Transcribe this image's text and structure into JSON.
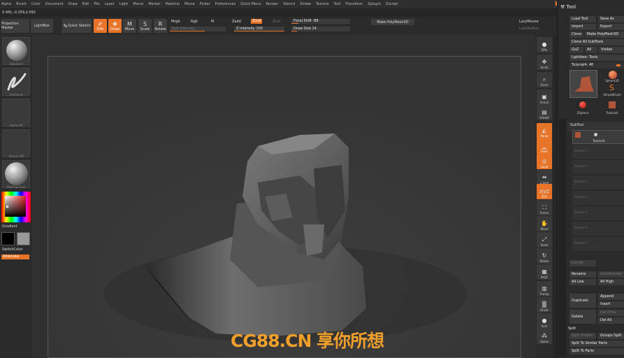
{
  "menu": [
    "Alpha",
    "Brush",
    "Color",
    "Document",
    "Draw",
    "Edit",
    "File",
    "Layer",
    "Light",
    "Macro",
    "Marker",
    "Material",
    "Movie",
    "Picker",
    "Preferences",
    "Quick Menu",
    "Render",
    "Stencil",
    "Stroke",
    "Texture",
    "Tool",
    "Transform",
    "Zplugin",
    "Zscript"
  ],
  "coords": "0.481,-0.259,2.092",
  "toolbar": {
    "projection_master": "Projection Master",
    "lightbox": "LightBox",
    "quick_sketch": "Quick Sketch",
    "edit": "Edit",
    "draw": "Draw",
    "move": "Move",
    "scale": "Scale",
    "rotate": "Rotate",
    "mrgb": "Mrgb",
    "rgb": "Rgb",
    "m": "M",
    "rgb_intensity": "Rgb Intensity",
    "zadd": "Zadd",
    "zsub": "Zsub",
    "zcut": "Zcut",
    "z_intensity": "Z Intensity 100",
    "focal_shift": "Focal Shift -88",
    "draw_size": "Draw Size 14",
    "make_polymesh": "Make PolyMesh3D",
    "lazymouse": "LazyMouse",
    "lazyradius": "LazyRadius"
  },
  "left": {
    "standard": "Standard",
    "freehand": "FreeHand",
    "alpha_off": "Alpha Off",
    "texture_off": "Texture Off",
    "matcap": "MatCap Gray",
    "gradient": "Gradient",
    "switchcolor": "SwitchColor",
    "alternate": "Alternate"
  },
  "right_strip": [
    {
      "label": "SPix",
      "icon": "spix-icon",
      "glyph": "●",
      "orange": false
    },
    {
      "label": "Scroll",
      "icon": "scroll-icon",
      "glyph": "✥",
      "orange": false
    },
    {
      "label": "Zoom",
      "icon": "zoom-icon",
      "glyph": "⌕",
      "orange": false
    },
    {
      "label": "Actual",
      "icon": "actual-icon",
      "glyph": "▣",
      "orange": false
    },
    {
      "label": "AAHalf",
      "icon": "aahalf-icon",
      "glyph": "▤",
      "orange": false
    },
    {
      "label": "Persp",
      "icon": "persp-icon",
      "glyph": "◭",
      "orange": true
    },
    {
      "label": "Floor",
      "icon": "floor-icon",
      "glyph": "▁",
      "orange": true
    },
    {
      "label": "Local",
      "icon": "local-icon",
      "glyph": "◎",
      "orange": true
    },
    {
      "label": "L.Sym",
      "icon": "lsym-icon",
      "glyph": "⇹",
      "orange": false
    },
    {
      "label": "XYZ",
      "icon": "xyz-icon",
      "glyph": "xyz",
      "orange": true
    },
    {
      "label": "Frame",
      "icon": "frame-icon",
      "glyph": "⛶",
      "orange": false
    },
    {
      "label": "Move",
      "icon": "move-icon",
      "glyph": "✋",
      "orange": false
    },
    {
      "label": "Scale",
      "icon": "scale-icon",
      "glyph": "⤢",
      "orange": false
    },
    {
      "label": "Rotate",
      "icon": "rotate-icon",
      "glyph": "↻",
      "orange": false
    },
    {
      "label": "PolyF",
      "icon": "polyf-icon",
      "glyph": "▦",
      "orange": false
    },
    {
      "label": "Transp",
      "icon": "transp-icon",
      "glyph": "▥",
      "orange": false
    },
    {
      "label": "Ghost",
      "icon": "ghost-icon",
      "glyph": "▒",
      "orange": false
    },
    {
      "label": "Solo",
      "icon": "solo-icon",
      "glyph": "●",
      "orange": false
    },
    {
      "label": "Xpose",
      "icon": "xpose-icon",
      "glyph": "⁂",
      "orange": false
    }
  ],
  "toolpanel": {
    "title": "Tool",
    "load_tool": "Load Tool",
    "save_as": "Save As",
    "import": "Import",
    "export": "Export",
    "clone": "Clone",
    "make_polymesh": "Make PolyMesh3D",
    "clone_all": "Clone All SubTools",
    "goz": "GoZ",
    "all": "All",
    "visible": "Visible",
    "lightbox_tools": "Lightbox› Tools",
    "current_tool": "Tutorial4. 48",
    "thumb_sphere": "Sphere3D",
    "thumb_simple": "SimpleBrush",
    "thumb_zsphere": "ZSphere",
    "thumb_tutorial": "Tutorial4",
    "subtool": "SubTool",
    "subtool_first": "Tutorial4",
    "subtool_slots": [
      "Subtool 1",
      "Subtool 2",
      "Subtool 3",
      "Subtool 4",
      "Subtool 5",
      "Subtool 6",
      "Subtool 7"
    ],
    "list_all": "List All",
    "rename": "Rename",
    "autoreorder": "AutoReorder",
    "all_low": "All Low",
    "all_high": "All High",
    "duplicate": "Duplicate",
    "append": "Append",
    "insert": "Insert",
    "delete": "Delete",
    "del_other": "Del Other",
    "del_all": "Del All",
    "split": "Split",
    "split_hidden": "Split Hidden",
    "groups_split": "Groups Split",
    "split_similar": "Split To Similar Parts",
    "split_parts": "Split To Parts"
  },
  "watermark": "CG88.CN 享你所想",
  "colors": {
    "accent": "#e8742a",
    "watermark": "#f0a02a"
  }
}
